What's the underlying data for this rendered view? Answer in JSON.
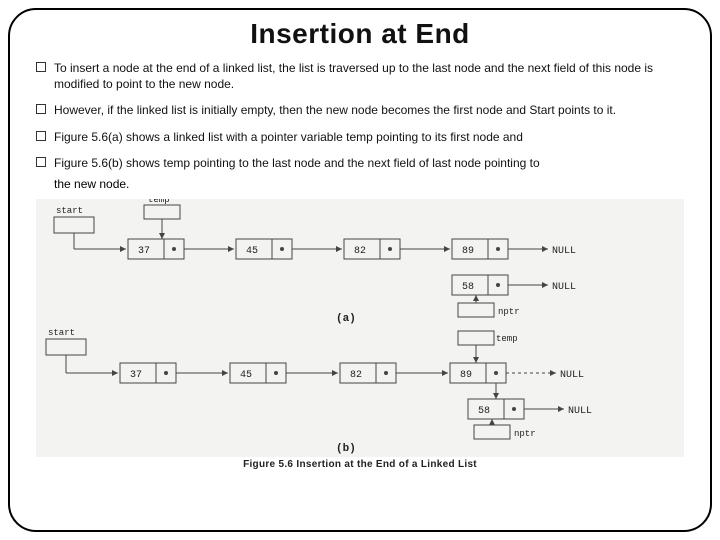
{
  "title": "Insertion at End",
  "bullets": [
    "To insert a node at the end of a linked list, the list is traversed up to the last node and the next field of this node is modified to point to the new node.",
    "However, if the linked list is initially empty, then the new node becomes the first node and Start points to it.",
    "Figure 5.6(a) shows a linked list with a pointer variable temp pointing to its first node and",
    "Figure 5.6(b) shows temp pointing to the last node and the next field of last node pointing to"
  ],
  "trailing": "the new node.",
  "figure": {
    "a": {
      "label": "(a)",
      "start": "start",
      "temp": "temp",
      "null": "NULL",
      "nptr": "nptr",
      "nodes": [
        "37",
        "45",
        "82",
        "89"
      ],
      "newNode": "58"
    },
    "b": {
      "label": "(b)",
      "start": "start",
      "temp": "temp",
      "null": "NULL",
      "null2": "NULL",
      "nptr": "nptr",
      "nodes": [
        "37",
        "45",
        "82",
        "89"
      ],
      "newNode": "58"
    },
    "caption": "Figure 5.6 Insertion at the End of a Linked List"
  }
}
